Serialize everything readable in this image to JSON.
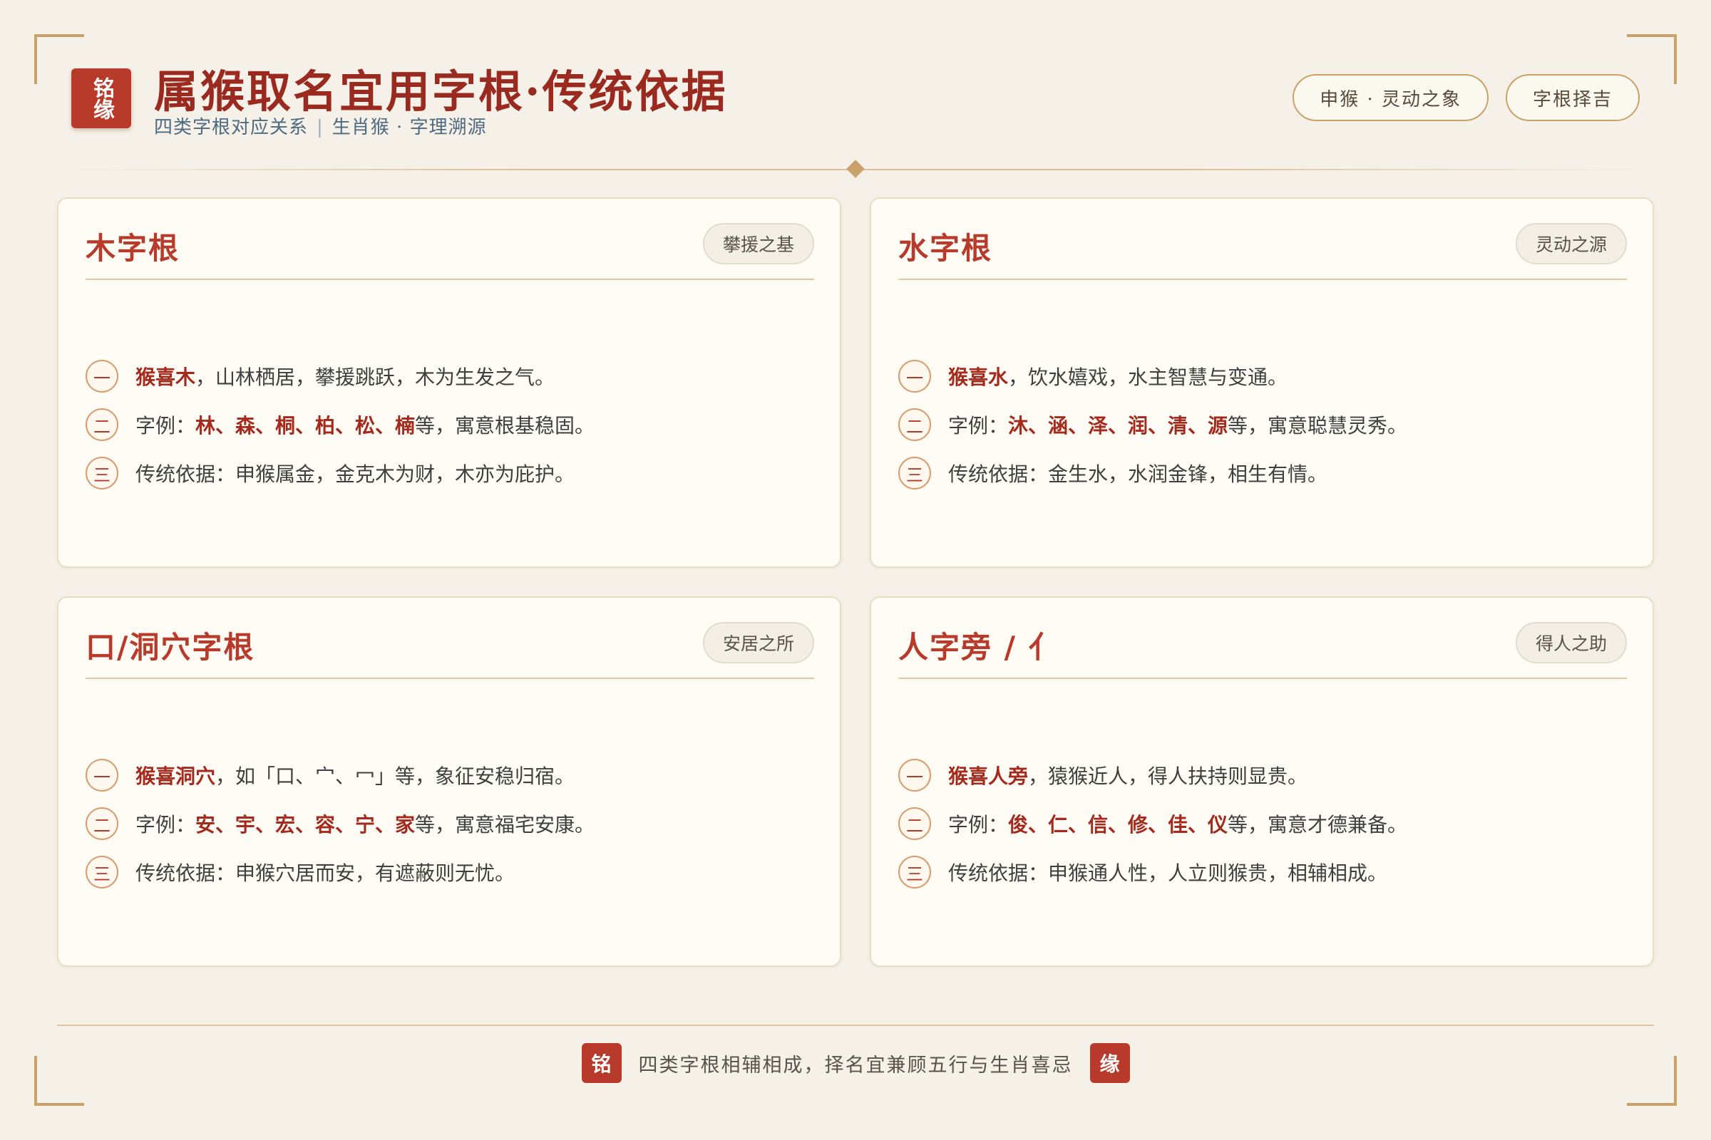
{
  "header": {
    "seal": "铭缘",
    "title": "属猴取名宜用字根·传统依据",
    "subtitle_left": "四类字根对应关系",
    "subtitle_sep": "|",
    "subtitle_right": "生肖猴 · 字理溯源",
    "tags": [
      "申猴 · 灵动之象",
      "字根择吉"
    ]
  },
  "cards": [
    {
      "title": "木字根",
      "tag": "攀援之基",
      "items": [
        {
          "num": "一",
          "hl": "猴喜木",
          "text": "，山林栖居，攀援跳跃，木为生发之气。"
        },
        {
          "num": "二",
          "pre": "字例：",
          "hl": "林、森、桐、柏、松、楠",
          "text": "等，寓意根基稳固。"
        },
        {
          "num": "三",
          "text": "传统依据：申猴属金，金克木为财，木亦为庇护。"
        }
      ]
    },
    {
      "title": "水字根",
      "tag": "灵动之源",
      "items": [
        {
          "num": "一",
          "hl": "猴喜水",
          "text": "，饮水嬉戏，水主智慧与变通。"
        },
        {
          "num": "二",
          "pre": "字例：",
          "hl": "沐、涵、泽、润、清、源",
          "text": "等，寓意聪慧灵秀。"
        },
        {
          "num": "三",
          "text": "传统依据：金生水，水润金锋，相生有情。"
        }
      ]
    },
    {
      "title": "口/洞穴字根",
      "tag": "安居之所",
      "items": [
        {
          "num": "一",
          "hl": "猴喜洞穴",
          "text": "，如「口、宀、冖」等，象征安稳归宿。"
        },
        {
          "num": "二",
          "pre": "字例：",
          "hl": "安、宇、宏、容、宁、家",
          "text": "等，寓意福宅安康。"
        },
        {
          "num": "三",
          "text": "传统依据：申猴穴居而安，有遮蔽则无忧。"
        }
      ]
    },
    {
      "title": "人字旁 / 亻",
      "tag": "得人之助",
      "items": [
        {
          "num": "一",
          "hl": "猴喜人旁",
          "text": "，猿猴近人，得人扶持则显贵。"
        },
        {
          "num": "二",
          "pre": "字例：",
          "hl": "俊、仁、信、修、佳、仪",
          "text": "等，寓意才德兼备。"
        },
        {
          "num": "三",
          "text": "传统依据：申猴通人性，人立则猴贵，相辅相成。"
        }
      ]
    }
  ],
  "footer": {
    "seal_left": "铭",
    "text": "四类字根相辅相成，择名宜兼顾五行与生肖喜忌",
    "seal_right": "缘"
  }
}
